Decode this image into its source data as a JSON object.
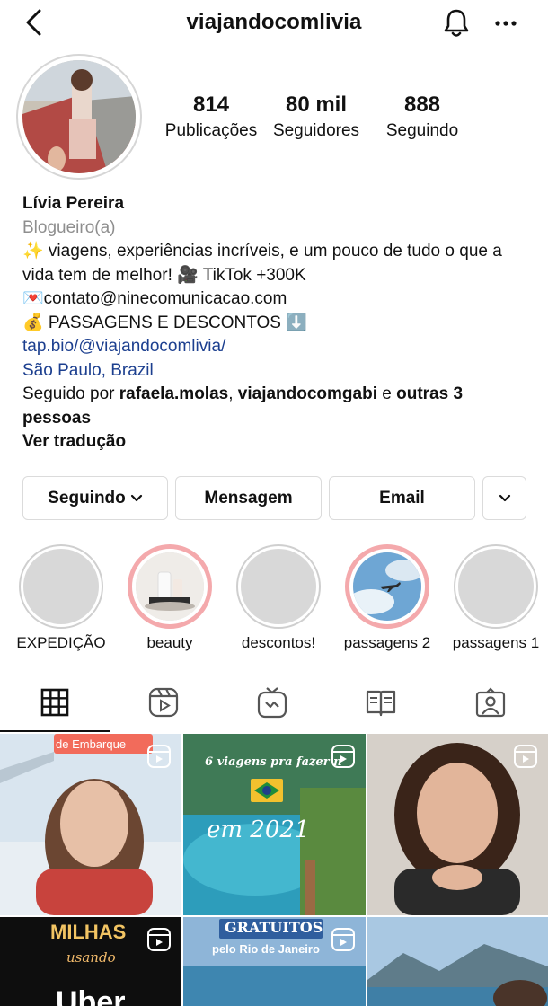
{
  "header": {
    "username": "viajandocomlivia",
    "back_icon": "chevron-left-icon",
    "bell_icon": "bell-icon",
    "more_icon": "more-horizontal-icon"
  },
  "stats": [
    {
      "value": "814",
      "label": "Publicações"
    },
    {
      "value": "80 mil",
      "label": "Seguidores"
    },
    {
      "value": "888",
      "label": "Seguindo"
    }
  ],
  "bio": {
    "name": "Lívia Pereira",
    "category": "Blogueiro(a)",
    "line1": "✨ viagens, experiências incríveis, e um pouco de tudo o que a vida tem de melhor! 🎥 TikTok +300K",
    "line2": "💌contato@ninecomunicacao.com",
    "line3": "💰 PASSAGENS E DESCONTOS ⬇️",
    "link": "tap.bio/@viajandocomlivia/",
    "location": "São Paulo, Brazil",
    "followed_prefix": "Seguido por ",
    "followed_user1": "rafaela.molas",
    "followed_sep": ", ",
    "followed_user2": "viajandocomgabi",
    "followed_and": " e ",
    "followed_others": "outras 3 pessoas",
    "translate": "Ver tradução"
  },
  "actions": {
    "following": "Seguindo",
    "message": "Mensagem",
    "email": "Email"
  },
  "highlights": [
    {
      "label": "EXPEDIÇÃO"
    },
    {
      "label": "beauty"
    },
    {
      "label": "descontos!"
    },
    {
      "label": "passagens 2"
    },
    {
      "label": "passagens 1"
    }
  ],
  "tabs": [
    "grid-icon",
    "reels-icon",
    "igtv-icon",
    "guides-icon",
    "tagged-icon"
  ],
  "posts": {
    "p1_text": "de Embarque",
    "p2_text_top": "6 viagens pra fazer n",
    "p2_text_bottom": "em 2021",
    "p4_text_top": "MILHAS",
    "p4_text_mid": "usando",
    "p4_text_bottom": "Uber",
    "p5_text_top": "GRATUITOS",
    "p5_text_mid": "pelo Rio de Janeiro"
  },
  "colors": {
    "link": "#1c3f8f",
    "highlight_ring": "#f4a9ac",
    "muted": "#8e8e8e",
    "border": "#dbdbdb"
  }
}
